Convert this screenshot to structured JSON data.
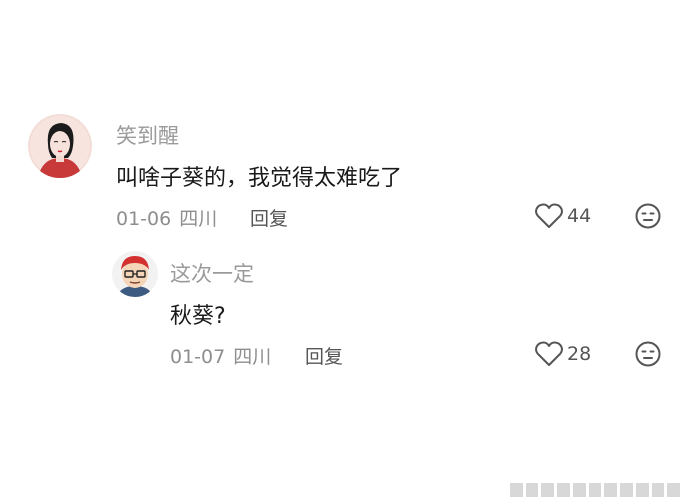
{
  "comments": [
    {
      "username": "笑到醒",
      "content": "叫啥子葵的，我觉得太难吃了",
      "date": "01-06",
      "location": "四川",
      "reply_label": "回复",
      "likes": "44",
      "avatar_icon": "woman-portrait-avatar"
    },
    {
      "username": "这次一定",
      "content": "秋葵?",
      "date": "01-07",
      "location": "四川",
      "reply_label": "回复",
      "likes": "28",
      "avatar_icon": "cartoon-man-avatar"
    }
  ],
  "colors": {
    "username": "#9a9a9a",
    "content": "#1a1a1a",
    "meta": "#8e8e8e",
    "icon": "#555555"
  }
}
